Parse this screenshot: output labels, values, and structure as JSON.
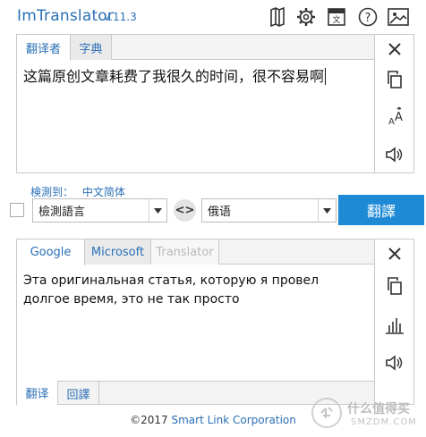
{
  "header": {
    "title": "ImTranslator",
    "version": "v.11.3",
    "icons": [
      "map-icon",
      "gear-icon",
      "dictionary-icon",
      "help-icon",
      "image-icon"
    ]
  },
  "source_panel": {
    "tabs": [
      {
        "label": "翻译者",
        "active": true
      },
      {
        "label": "字典",
        "active": false
      }
    ],
    "text": "这篇原创文章耗费了我很久的时间，很不容易啊",
    "side_icons": [
      "close-icon",
      "copy-icon",
      "font-size-icon",
      "speaker-icon"
    ]
  },
  "detection": {
    "label": "検測到：",
    "language": "中文简体"
  },
  "controls": {
    "source_lang": "檢測語言",
    "swap_symbol": "<>",
    "target_lang": "俄语",
    "translate_label": "翻譯"
  },
  "result_panel": {
    "tabs": [
      {
        "label": "Google",
        "active": true
      },
      {
        "label": "Microsoft",
        "active": false
      },
      {
        "label": "Translator",
        "active": false,
        "disabled": true
      }
    ],
    "text": "Эта оригинальная статья, которую я провел долгое время, это не так просто",
    "bottom_tabs": [
      {
        "label": "翻译",
        "active": true
      },
      {
        "label": "回譯",
        "active": false
      }
    ],
    "side_icons": [
      "close-icon",
      "copy-icon",
      "bar-chart-icon",
      "speaker-icon"
    ]
  },
  "footer": {
    "copyright": "©2017",
    "company": "Smart Link Corporation"
  },
  "watermark": {
    "text": "什么值得买",
    "site": "SMZDM.COM"
  },
  "colors": {
    "accent": "#2a6fb5",
    "button": "#1e8ad6",
    "border": "#c9c9c9"
  }
}
